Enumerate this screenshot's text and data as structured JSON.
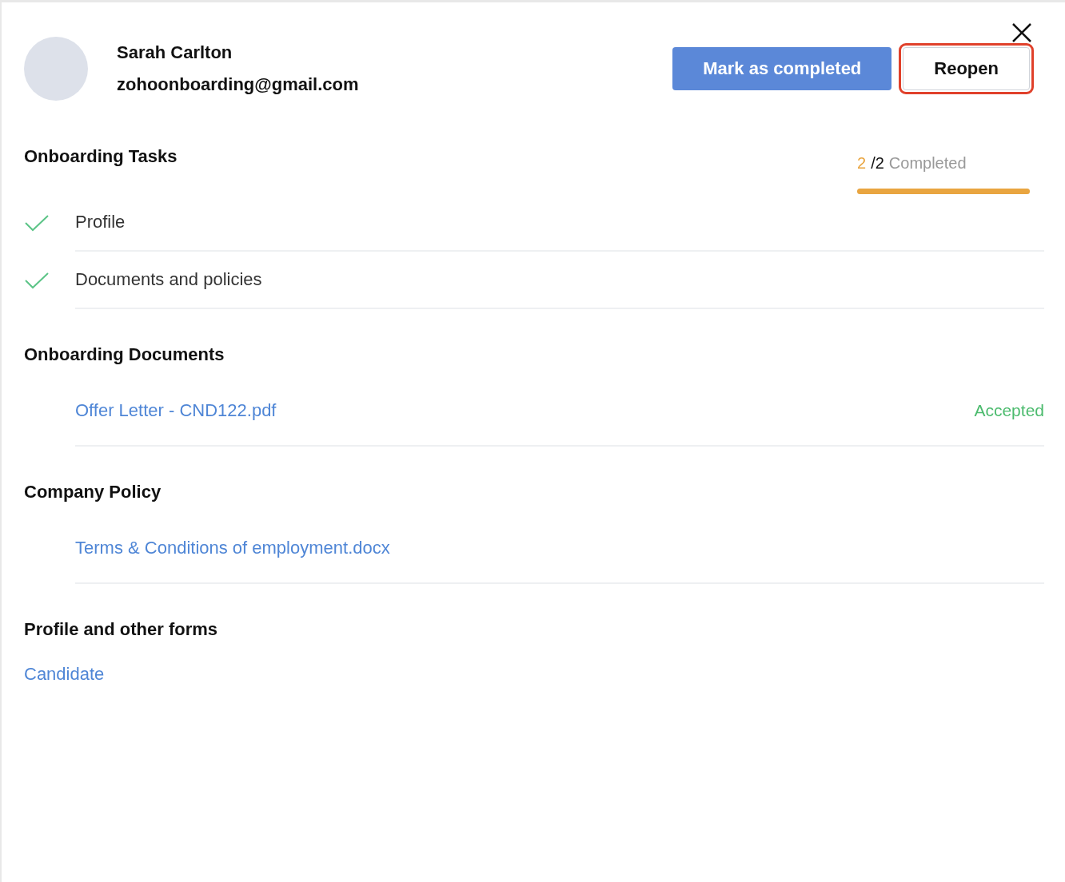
{
  "candidate": {
    "name": "Sarah Carlton",
    "email": "zohoonboarding@gmail.com"
  },
  "actions": [
    {
      "label": "Mark as completed",
      "kind": "primary",
      "highlighted": false
    },
    {
      "label": "Reopen",
      "kind": "secondary",
      "highlighted": true
    }
  ],
  "tasks_section": {
    "title": "Onboarding Tasks",
    "progress": {
      "done": "2",
      "total": "/2",
      "label": "Completed",
      "level": 1
    },
    "tasks": [
      {
        "label": "Profile",
        "completed": true
      },
      {
        "label": "Documents and policies",
        "completed": true
      }
    ]
  },
  "sections": [
    {
      "title": "Onboarding Documents",
      "items": [
        {
          "label": "Offer Letter - CND122.pdf",
          "status": "Accepted"
        }
      ]
    },
    {
      "title": "Company Policy",
      "items": [
        {
          "label": "Terms & Conditions of employment.docx"
        }
      ]
    }
  ],
  "forms": {
    "title": "Profile and other forms",
    "links": [
      "Candidate"
    ]
  }
}
